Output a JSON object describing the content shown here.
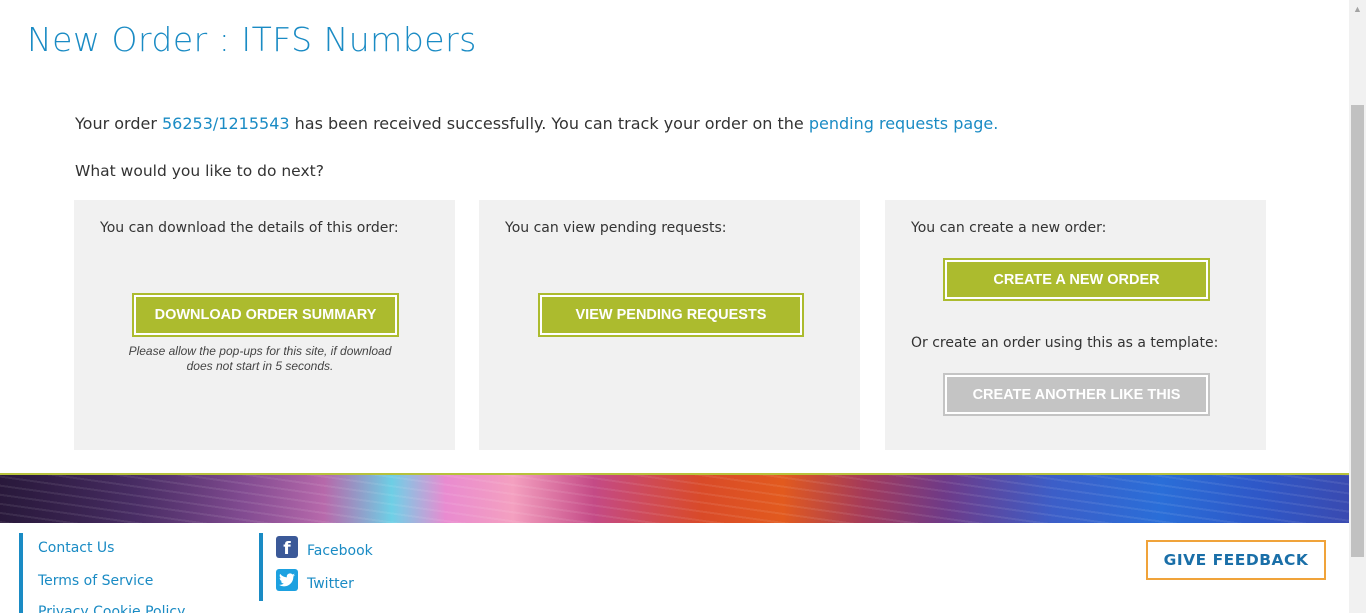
{
  "page": {
    "title": "New Order : ITFS Numbers"
  },
  "confirmation": {
    "prefix": "Your order ",
    "order_number": "56253/1215543",
    "middle": " has been received successfully. You can track your order on the ",
    "link_text": "pending requests page."
  },
  "next_question": "What would you like to do next?",
  "panels": {
    "download": {
      "label": "You can download the details of this order:",
      "button": "DOWNLOAD ORDER SUMMARY",
      "note": "Please allow the pop-ups for this site, if download does not start in 5 seconds."
    },
    "pending": {
      "label": "You can view pending requests:",
      "button": "VIEW PENDING REQUESTS"
    },
    "create": {
      "label": "You can create a new order:",
      "button": "CREATE A NEW ORDER",
      "template_label": "Or create an order using this as a template:",
      "template_button": "CREATE ANOTHER LIKE THIS"
    }
  },
  "footer": {
    "links": [
      "Contact Us",
      "Terms of Service",
      "Privacy Cookie Policy"
    ],
    "social": [
      {
        "label": "Facebook",
        "icon": "facebook-icon"
      },
      {
        "label": "Twitter",
        "icon": "twitter-icon"
      }
    ],
    "feedback_button": "GIVE FEEDBACK"
  },
  "colors": {
    "accent_blue": "#1a8bc4",
    "button_green": "#acbb2e",
    "button_disabled": "#c4c4c4",
    "feedback_border": "#f0a33a"
  }
}
